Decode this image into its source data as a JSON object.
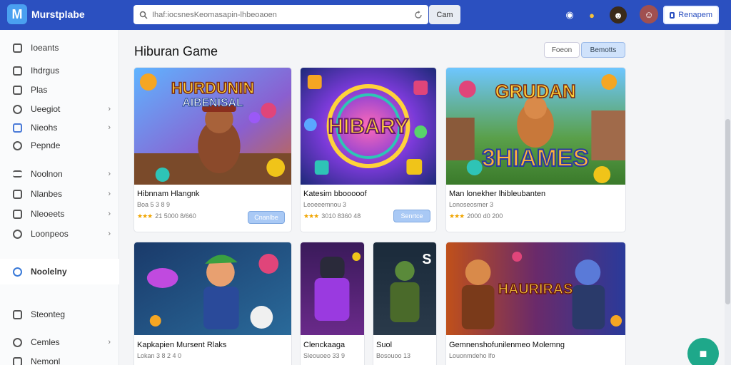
{
  "header": {
    "app_name": "Murstplabe",
    "search_placeholder": "Ihaf:iocsnesKeomasapin-lhbeoaoen",
    "search_button": "Cam",
    "action_button": "Renapem"
  },
  "sidebar": {
    "items": [
      {
        "label": "Ioeants",
        "chevron": false
      },
      {
        "label": "Ihdrgus",
        "chevron": false
      },
      {
        "label": "Plas",
        "chevron": false
      },
      {
        "label": "Ueegiot",
        "chevron": true
      },
      {
        "label": "Nieohs",
        "chevron": true
      },
      {
        "label": "Pepnde",
        "chevron": false
      },
      {
        "label": "Noolnon",
        "chevron": true
      },
      {
        "label": "Nlanbes",
        "chevron": true
      },
      {
        "label": "Nleoeets",
        "chevron": true
      },
      {
        "label": "Loonpeos",
        "chevron": true
      },
      {
        "label": "Noolelny",
        "chevron": false,
        "active": true
      },
      {
        "label": "Steonteg",
        "chevron": false
      },
      {
        "label": "Cemles",
        "chevron": true
      },
      {
        "label": "Nemonl",
        "chevron": false
      }
    ]
  },
  "main": {
    "title": "Hiburan Game",
    "filters": [
      "Foeon",
      "Bemotts"
    ],
    "cards": [
      {
        "title": "Hibnnam Hlangnk",
        "sub": "Boa 5 3 8 9",
        "rating": "21 5000 8/660",
        "button": "Cnanlbe",
        "art_text_1": "HURDUNIN",
        "art_text_2": "AIBENISAL"
      },
      {
        "title": "Katesim bbooooof",
        "sub": "Leoeeemnou 3",
        "rating": "3010 8360 48",
        "button": "Senrtce",
        "art_text_1": "HIBARY",
        "art_text_2": ""
      },
      {
        "title": "Man lonekher lhibleubanten",
        "sub": "Lonoseosmer 3",
        "rating": "2000 d0 200",
        "button": "",
        "art_text_1": "GRUDAN",
        "art_text_2": "3HIAMES"
      },
      {
        "title": "Kapkapien Mursent Rlaks",
        "sub": "Lokan 3 8 2 4 0",
        "rating": "",
        "button": "",
        "art_text_1": "",
        "art_text_2": ""
      },
      {
        "title": "Clenckaaga",
        "sub": "Sleouoeo 33 9",
        "rating": "",
        "button": "",
        "art_text_1": "",
        "art_text_2": ""
      },
      {
        "title": "Suol",
        "sub": "Bosouoo 13",
        "rating": "",
        "button": "",
        "art_text_1": "",
        "art_text_2": ""
      },
      {
        "title": "Gemnenshofunilenmeo Molemng",
        "sub": "Louonmdeho lfo",
        "rating": "",
        "button": "",
        "art_text_1": "HAURIRAS",
        "art_text_2": ""
      }
    ]
  },
  "colors": {
    "header": "#2b50c0",
    "accent": "#4aa0f0",
    "fab": "#1ea88a"
  }
}
